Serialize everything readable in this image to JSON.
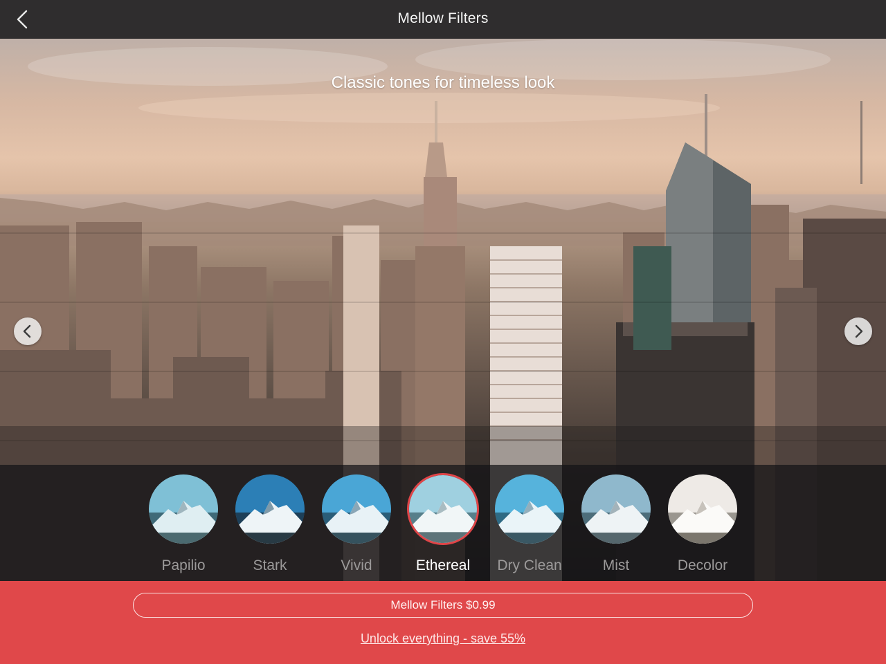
{
  "header": {
    "title": "Mellow Filters",
    "back_icon": "chevron-left-icon"
  },
  "hero": {
    "tagline": "Classic tones for timeless look",
    "prev_icon": "chevron-left-icon",
    "next_icon": "chevron-right-icon"
  },
  "filters": {
    "selected": "Ethereal",
    "accent": "#e04548",
    "items": [
      {
        "label": "Papilio"
      },
      {
        "label": "Stark"
      },
      {
        "label": "Vivid"
      },
      {
        "label": "Ethereal"
      },
      {
        "label": "Dry Clean"
      },
      {
        "label": "Mist"
      },
      {
        "label": "Decolor"
      }
    ]
  },
  "purchase": {
    "price_label": "Mellow Filters $0.99",
    "unlock_label": "Unlock everything - save 55%",
    "background": "#e0484a"
  }
}
